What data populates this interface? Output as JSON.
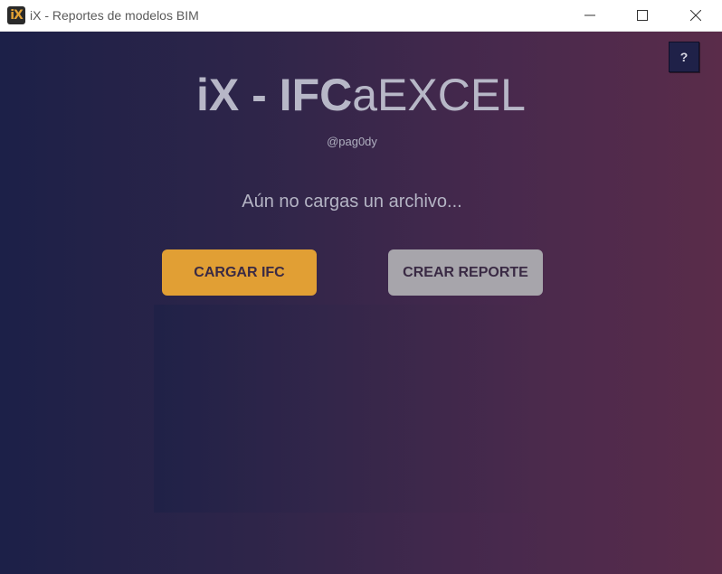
{
  "window": {
    "title": "iX - Reportes de modelos BIM",
    "icon_label": "iX",
    "icon_name": "app-logo-icon",
    "controls": [
      "minimize-icon",
      "maximize-icon",
      "close-icon"
    ]
  },
  "help_button": {
    "label": "?"
  },
  "header": {
    "title_bold_1": "iX",
    "title_dash": " - ",
    "title_bold_2": "IFC",
    "title_rest": "aEXCEL",
    "subtitle": "@pag0dy"
  },
  "status_text": "Aún no cargas un archivo...",
  "buttons": {
    "load": "CARGAR IFC",
    "report": "CREAR REPORTE"
  },
  "colors": {
    "background_left": "#1c2048",
    "background_right": "#5a2c4a",
    "load_button": "#e19f34",
    "report_button": "#a7a5ab",
    "text": "#b7b7c7"
  }
}
